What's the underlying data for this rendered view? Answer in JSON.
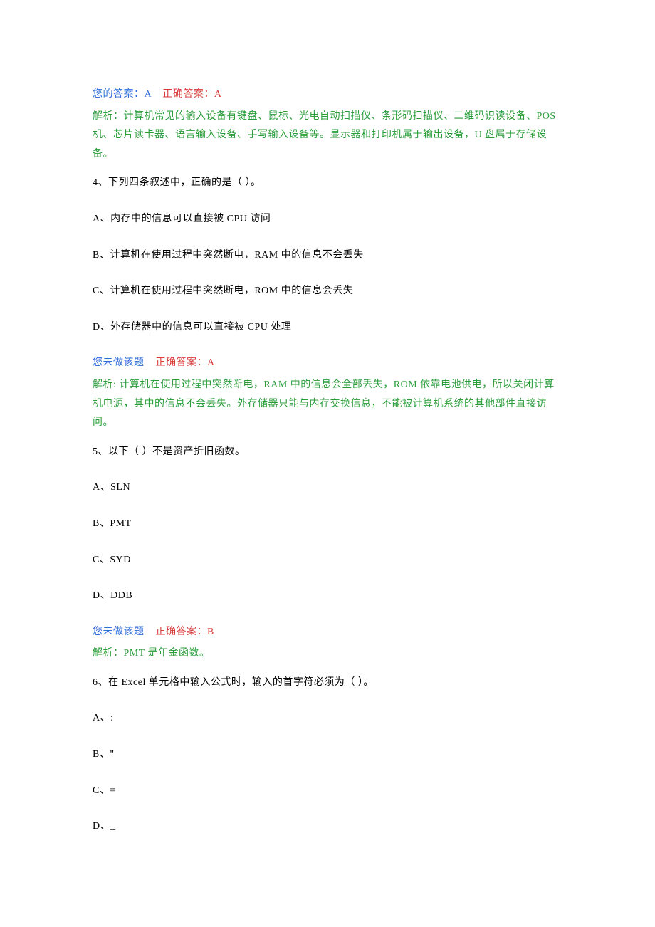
{
  "q3": {
    "your_answer_label": "您的答案：A",
    "correct_answer_label": "正确答案：A",
    "analysis_label": "解析：",
    "analysis_text": "计算机常见的输入设备有键盘、鼠标、光电自动扫描仪、条形码扫描仪、二维码识读设备、POS 机、芯片读卡器、语言输入设备、手写输入设备等。显示器和打印机属于输出设备，U 盘属于存储设备。"
  },
  "q4": {
    "question": "4、下列四条叙述中，正确的是（  ）。",
    "options": {
      "a": "A、内存中的信息可以直接被 CPU 访问",
      "b": "B、计算机在使用过程中突然断电，RAM 中的信息不会丢失",
      "c": "C、计算机在使用过程中突然断电，ROM 中的信息会丢失",
      "d": "D、外存储器中的信息可以直接被 CPU 处理"
    },
    "not_answered_label": "您未做该题",
    "correct_answer_label": "正确答案：A",
    "analysis_label": "解析: ",
    "analysis_text": "计算机在使用过程中突然断电，RAM 中的信息会全部丢失，ROM 依靠电池供电，所以关闭计算机电源，其中的信息不会丢失。外存储器只能与内存交换信息，不能被计算机系统的其他部件直接访问。"
  },
  "q5": {
    "question": "5、以下（  ）不是资产折旧函数。",
    "options": {
      "a": "A、SLN",
      "b": "B、PMT",
      "c": "C、SYD",
      "d": "D、DDB"
    },
    "not_answered_label": "您未做该题",
    "correct_answer_label": "正确答案：B",
    "analysis_label": "解析：",
    "analysis_text": "PMT 是年金函数。"
  },
  "q6": {
    "question": "6、在 Excel 单元格中输入公式时，输入的首字符必须为（  ）。",
    "options": {
      "a": "A、:",
      "b": "B、\"",
      "c": "C、=",
      "d": "D、_"
    }
  }
}
